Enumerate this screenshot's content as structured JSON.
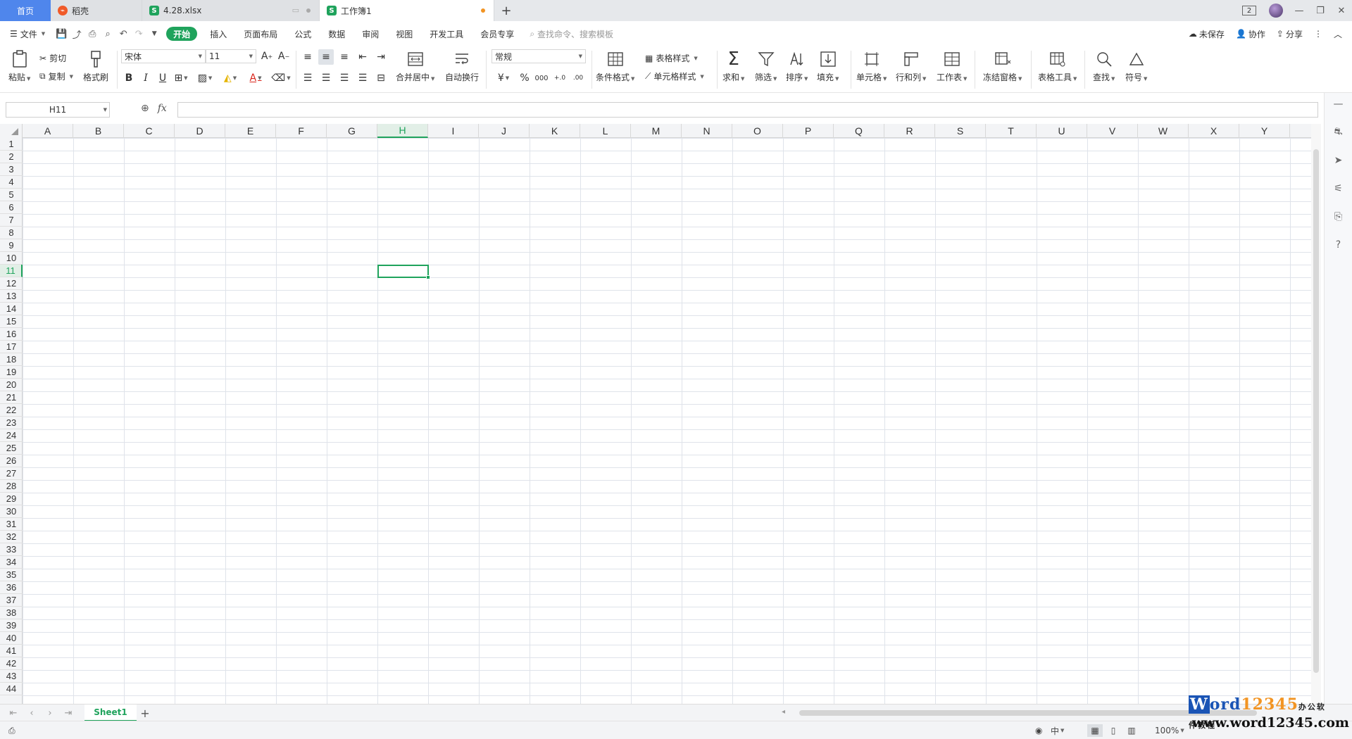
{
  "tabs": {
    "home": "首页",
    "daoke": "稻壳",
    "file": "4.28.xlsx",
    "book": "工作簿1",
    "add": "+"
  },
  "window": {
    "badge": "2"
  },
  "menu": {
    "file": "文件",
    "items": [
      "开始",
      "插入",
      "页面布局",
      "公式",
      "数据",
      "审阅",
      "视图",
      "开发工具",
      "会员专享"
    ],
    "search_placeholder": "查找命令、搜索模板",
    "unsaved": "未保存",
    "collab": "协作",
    "share": "分享"
  },
  "ribbon": {
    "paste": "粘贴",
    "cut": "剪切",
    "copy": "复制",
    "format_painter": "格式刷",
    "font_name": "宋体",
    "font_size": "11",
    "merge_center": "合并居中",
    "wrap_text": "自动换行",
    "number_format": "常规",
    "conditional_format": "条件格式",
    "table_style": "表格样式",
    "cell_style": "单元格样式",
    "sum": "求和",
    "filter": "筛选",
    "sort": "排序",
    "fill": "填充",
    "cells": "单元格",
    "rows_cols": "行和列",
    "worksheet": "工作表",
    "freeze": "冻结窗格",
    "table_tools": "表格工具",
    "find": "查找",
    "symbol": "符号",
    "currency": "¥",
    "percent": "%",
    "thousands": "000",
    "inc_decimal": "+.0",
    "dec_decimal": ".00"
  },
  "formula": {
    "name_box": "H11",
    "fx": "fx",
    "content": ""
  },
  "grid": {
    "columns": [
      "A",
      "B",
      "C",
      "D",
      "E",
      "F",
      "G",
      "H",
      "I",
      "J",
      "K",
      "L",
      "M",
      "N",
      "O",
      "P",
      "Q",
      "R",
      "S",
      "T",
      "U",
      "V",
      "W",
      "X",
      "Y"
    ],
    "rows": [
      "1",
      "2",
      "3",
      "4",
      "5",
      "6",
      "7",
      "8",
      "9",
      "10",
      "11",
      "12",
      "13",
      "14",
      "15",
      "16",
      "17",
      "18",
      "19",
      "20",
      "21",
      "22",
      "23",
      "24",
      "25",
      "26",
      "27",
      "28",
      "29",
      "30",
      "31",
      "32",
      "33",
      "34",
      "35",
      "36",
      "37",
      "38",
      "39",
      "40",
      "41",
      "42",
      "43",
      "44"
    ],
    "selected_column": "H",
    "selected_row": "11"
  },
  "sheets": {
    "active": "Sheet1"
  },
  "status": {
    "input_mode": "中",
    "zoom": "100%"
  },
  "watermark": {
    "brand_w": "W",
    "brand_rest": "ord",
    "brand_num": "12345",
    "brand_sub": "办公软件教程",
    "url": "www.word12345.com"
  },
  "colors": {
    "accent": "#1fa35c",
    "tab_home": "#4f86ec"
  }
}
